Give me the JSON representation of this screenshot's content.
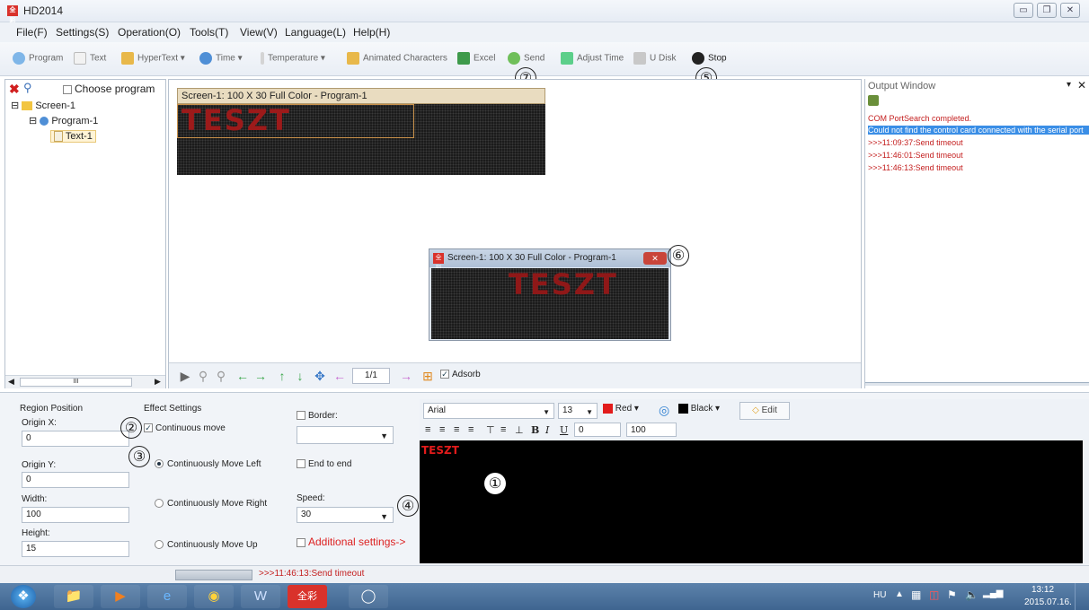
{
  "window": {
    "title": "HD2014",
    "app_icon_text": "全彩"
  },
  "menu": [
    "File(F)",
    "Settings(S)",
    "Operation(O)",
    "Tools(T)",
    "View(V)",
    "Language(L)",
    "Help(H)"
  ],
  "toolbar": {
    "program": "Program",
    "text": "Text",
    "hypertext": "HyperText",
    "time": "Time",
    "temperature": "Temperature",
    "animated": "Animated Characters",
    "excel": "Excel",
    "send": "Send",
    "adjust_time": "Adjust Time",
    "udisk": "U Disk",
    "stop": "Stop"
  },
  "annotations": {
    "n1": "①",
    "n2": "②",
    "n3": "③",
    "n4": "④",
    "n5": "⑤",
    "n6": "⑥",
    "n7": "⑦"
  },
  "tree": {
    "choose_program": "Choose program",
    "screen": "Screen-1",
    "program": "Program-1",
    "text": "Text-1",
    "scroll_label": "III"
  },
  "canvas": {
    "screen_title": "Screen-1: 100 X 30 Full Color - Program-1",
    "led_text": "TESZT",
    "popup_title": "Screen-1: 100 X 30 Full Color - Program-1",
    "page": "1/1",
    "adsorb": "Adsorb"
  },
  "output": {
    "title": "Output Window",
    "lines": [
      "COM PortSearch completed.",
      "Could not find the control card connected with the serial port",
      ">>>11:09:37:Send timeout",
      ">>>11:46:01:Send timeout",
      ">>>11:46:13:Send timeout"
    ]
  },
  "region": {
    "title": "Region Position",
    "origin_x_label": "Origin X:",
    "origin_x": "0",
    "origin_y_label": "Origin Y:",
    "origin_y": "0",
    "width_label": "Width:",
    "width": "100",
    "height_label": "Height:",
    "height": "15"
  },
  "effect": {
    "title": "Effect Settings",
    "continuous_move": "Continuous move",
    "move_left": "Continuously Move Left",
    "move_right": "Continuously Move Right",
    "move_up": "Continuously Move Up",
    "border": "Border:",
    "end_to_end": "End to end",
    "speed_label": "Speed:",
    "speed": "30",
    "additional": "Additional settings->"
  },
  "editor": {
    "font": "Arial",
    "size": "13",
    "fg_color": "Red",
    "bg_color": "Black",
    "edit": "Edit",
    "spacing": "0",
    "scale": "100",
    "content": "TESZT",
    "colors": {
      "red": "#e21b1b",
      "black": "#000000"
    }
  },
  "status": {
    "message": ">>>11:46:13:Send timeout"
  },
  "taskbar": {
    "lang": "HU",
    "time": "13:12",
    "date": "2015.07.16."
  }
}
